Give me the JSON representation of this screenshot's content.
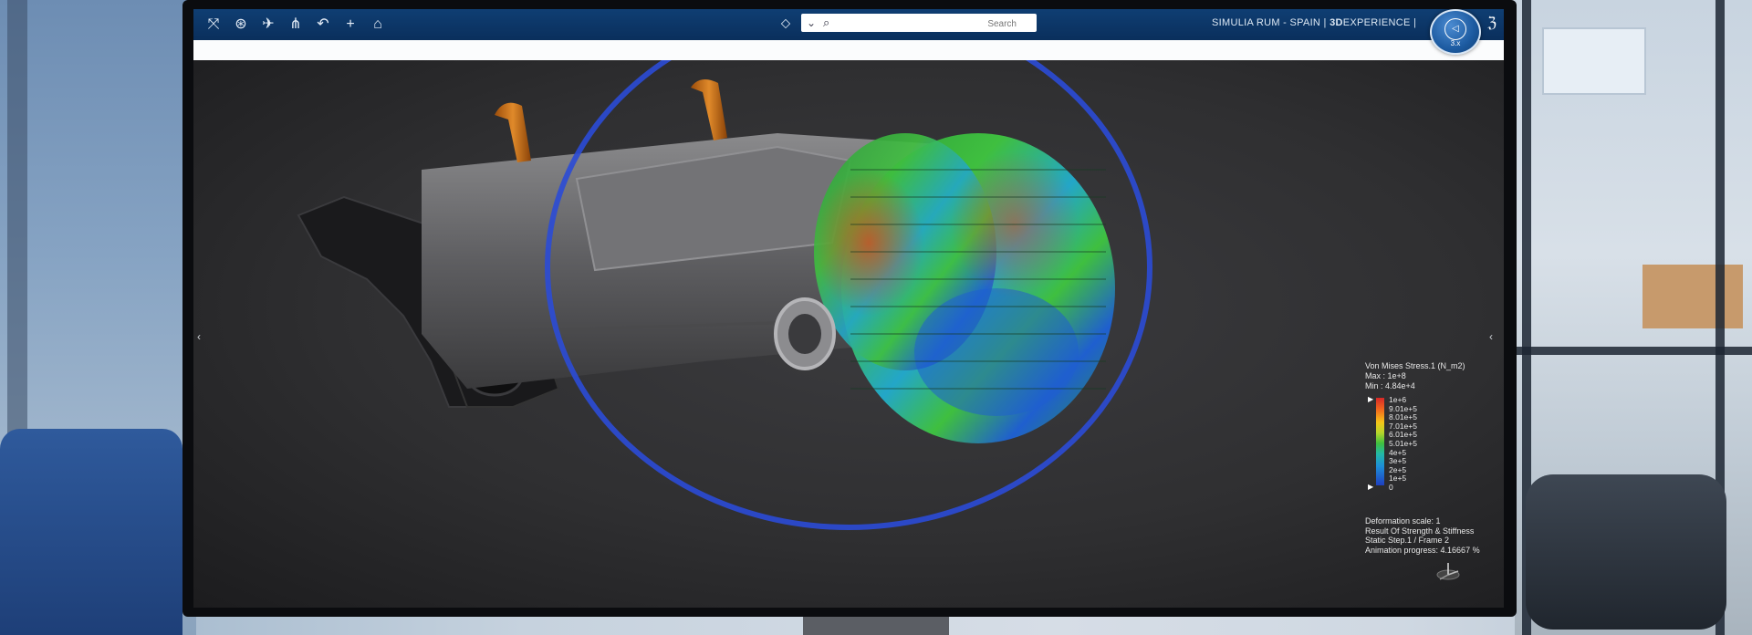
{
  "app": {
    "brand_bold": "3D",
    "brand_rest": "EXPERIENCE",
    "separator": "|",
    "context": "SIMULIA RUM - SPAIN",
    "compass_version": "3.x"
  },
  "toolbar": {
    "icons": [
      "expand-icon",
      "settings-icon",
      "plane-icon",
      "share-icon",
      "reply-icon",
      "plus-icon",
      "tag-icon"
    ],
    "search_placeholder": "Search"
  },
  "legend": {
    "title": "Von Mises Stress.1 (N_m2)",
    "max": "Max : 1e+8",
    "min": "Min : 4.84e+4",
    "ticks": [
      "1e+6",
      "9.01e+5",
      "8.01e+5",
      "7.01e+5",
      "6.01e+5",
      "5.01e+5",
      "4e+5",
      "3e+5",
      "2e+5",
      "1e+5",
      "0"
    ],
    "colors": [
      "#d62728",
      "#f26b1d",
      "#f5c518",
      "#b6d62b",
      "#3fbf3f",
      "#23b8a6",
      "#1d8fd8",
      "#1f3fbf"
    ]
  },
  "results": [
    "Deformation scale: 1",
    "Result Of Strength & Stiffness",
    "Static Step.1 / Frame 2",
    "Animation progress: 4.16667 %"
  ],
  "highlight_color": "#2b4bd6"
}
